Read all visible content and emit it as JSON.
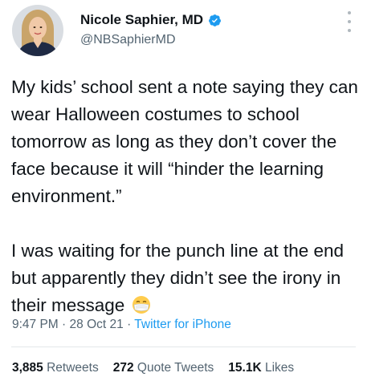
{
  "author": {
    "display_name": "Nicole Saphier, MD",
    "handle": "@NBSaphierMD",
    "verified": true,
    "avatar_icon": "profile-photo"
  },
  "tweet": {
    "paragraph_1": "My kids’ school sent a note saying they can wear Halloween costumes to school tomorrow as long as they don’t cover the face because it will “hinder the learning environment.”",
    "paragraph_2": "I was waiting for the punch line at the end but apparently they didn’t see the irony in their message",
    "emoji": "face-with-medical-mask-icon"
  },
  "meta": {
    "time": "9:47 PM",
    "date": "28 Oct 21",
    "separator": "·",
    "source": "Twitter for iPhone"
  },
  "stats": {
    "retweets_count": "3,885",
    "retweets_label": "Retweets",
    "quotes_count": "272",
    "quotes_label": "Quote Tweets",
    "likes_count": "15.1K",
    "likes_label": "Likes"
  },
  "colors": {
    "text": "#0f1419",
    "secondary": "#536471",
    "accent": "#1d9bf0"
  }
}
